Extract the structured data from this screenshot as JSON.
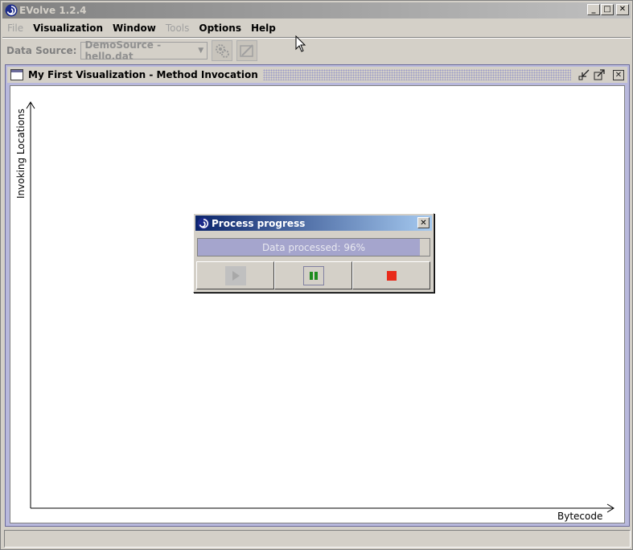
{
  "window": {
    "title": "EVolve 1.2.4"
  },
  "menu": {
    "items": [
      {
        "label": "File",
        "enabled": false
      },
      {
        "label": "Visualization",
        "enabled": true
      },
      {
        "label": "Window",
        "enabled": true
      },
      {
        "label": "Tools",
        "enabled": false
      },
      {
        "label": "Options",
        "enabled": true
      },
      {
        "label": "Help",
        "enabled": true
      }
    ]
  },
  "toolbar": {
    "data_source_label": "Data Source:",
    "data_source_value": "DemoSource - hello.dat"
  },
  "visualization": {
    "title": "My First Visualization - Method Invocation",
    "y_axis_label": "Invoking Locations",
    "x_axis_label": "Bytecode"
  },
  "progress_dialog": {
    "title": "Process progress",
    "progress_text": "Data processed: 96%",
    "progress_percent": 96
  },
  "colors": {
    "dialog_title_start": "#0a246a",
    "dialog_title_end": "#a6caf0",
    "progress_fill": "#a5a5cd",
    "pause_green": "#1e8c1e",
    "stop_red": "#e82a1a"
  }
}
